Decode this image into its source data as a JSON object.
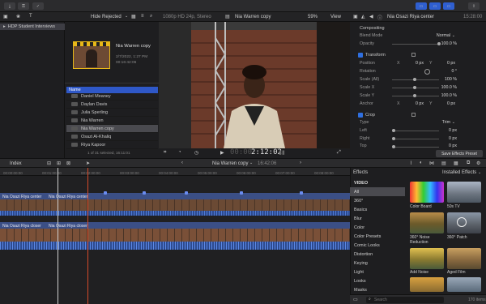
{
  "toolbar": {
    "import_icon": "download-icon",
    "keywords_icon": "key-icon",
    "check_icon": "checkmark-icon",
    "right_icons": [
      "share-icon"
    ]
  },
  "browser": {
    "filter_label": "Hide Rejected",
    "library_name": "HDP Student Interviews",
    "selected_clip": {
      "title": "Nia Warren copy",
      "date": "2/7/2022, 1:27 PM",
      "duration": "00:16:42:06"
    },
    "list_header": "Name",
    "clips": [
      "Daniel Meaney",
      "Daylan Davis",
      "Julia Sperling",
      "Nia Warren",
      "Nia Warren copy",
      "Osazi Al-Khaliq",
      "Riya Kapoor"
    ],
    "status": "1 of 31 selected, 16:11:01"
  },
  "viewer": {
    "format": "1080p HD 24p, Stereo",
    "clip_name": "Nia Warren copy",
    "zoom": "59%",
    "view_label": "View",
    "timecode": "2:12:02",
    "timecode_prefix": "00:00"
  },
  "inspector": {
    "clip_name": "Nia Osazi Riya center",
    "duration": "15:28:00",
    "compositing_label": "Compositing",
    "blend_mode_label": "Blend Mode",
    "blend_mode_value": "Normal",
    "opacity_label": "Opacity",
    "opacity_value": "100.0 %",
    "transform_label": "Transform",
    "position_label": "Position",
    "position_x": "0 px",
    "position_y": "0 px",
    "rotation_label": "Rotation",
    "rotation_value": "0 °",
    "scale_all_label": "Scale (All)",
    "scale_all_value": "100 %",
    "scale_x_label": "Scale X",
    "scale_x_value": "100.0 %",
    "scale_y_label": "Scale Y",
    "scale_y_value": "100.0 %",
    "anchor_label": "Anchor",
    "anchor_x": "0 px",
    "anchor_y": "0 px",
    "crop_label": "Crop",
    "type_label": "Type",
    "type_value": "Trim",
    "left_label": "Left",
    "left_value": "0 px",
    "right_label": "Right",
    "right_value": "0 px",
    "top_label": "Top",
    "top_value": "0 px",
    "x_label": "X",
    "y_label": "Y",
    "save_preset_label": "Save Effects Preset"
  },
  "timeline": {
    "index_label": "Index",
    "project_name": "Nia Warren copy",
    "project_duration": "16:42:06",
    "ruler": [
      "00:00:00:00",
      "00:01:00:00",
      "00:02:00:00",
      "00:03:00:00",
      "00:04:00:00",
      "00:05:00:00",
      "00:06:00:00",
      "00:07:00:00",
      "00:08:00:00"
    ],
    "clip_top": "Nia Osazi Riya center",
    "clip_bottom": "Nia Osazi Riya closer"
  },
  "effects": {
    "title": "Effects",
    "installed_label": "Installed Effects",
    "category_header": "VIDEO",
    "categories": [
      "All",
      "360°",
      "Basics",
      "Blur",
      "Color",
      "Color Presets",
      "Comic Looks",
      "Distortion",
      "Keying",
      "Light",
      "Looks",
      "Masks"
    ],
    "items": [
      "Color Board",
      "50s TV",
      "360° Noise Reduction",
      "360° Patch",
      "Add Noise",
      "Aged Film"
    ],
    "search_placeholder": "Search",
    "count": "170 items"
  }
}
